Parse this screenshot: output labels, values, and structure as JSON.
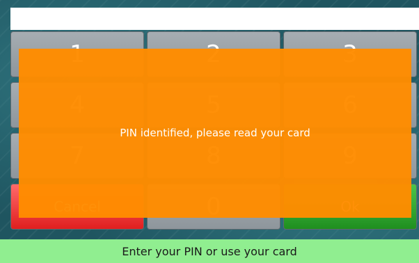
{
  "pin_input": {
    "value": "",
    "placeholder": ""
  },
  "keypad": {
    "keys": [
      "1",
      "2",
      "3",
      "4",
      "5",
      "6",
      "7",
      "8",
      "9"
    ],
    "cancel_label": "Cancel",
    "zero_label": "0",
    "ok_label": "Ok"
  },
  "overlay": {
    "message": "PIN identified, please read your card"
  },
  "status_bar": {
    "text": "Enter your PIN or use your card"
  },
  "colors": {
    "overlay": "#FF8C00",
    "cancel": "#E01F1F",
    "ok": "#1F8F1F",
    "status_bar": "#90EE90"
  }
}
